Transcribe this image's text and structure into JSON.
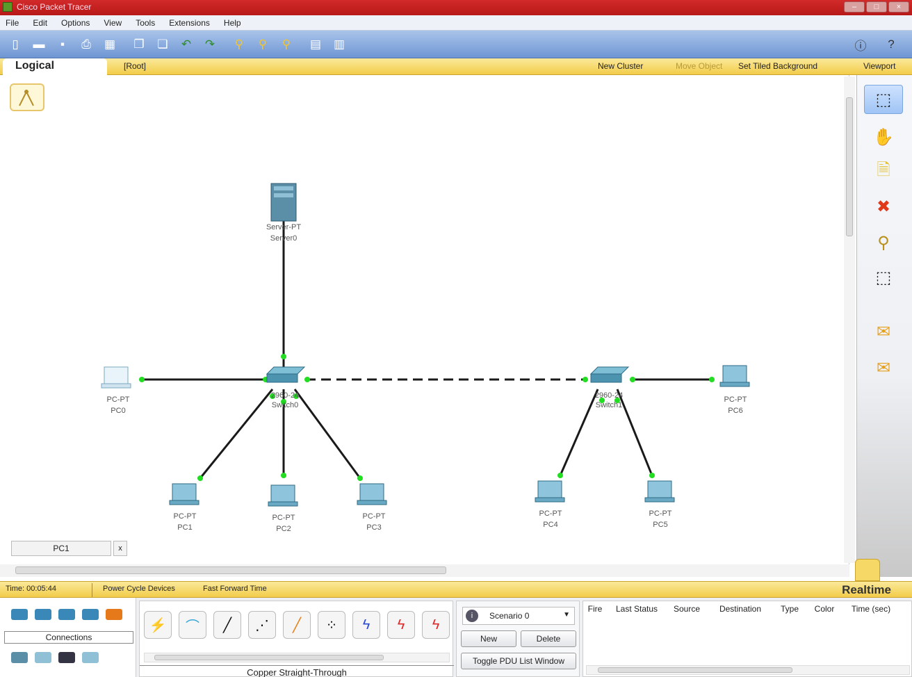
{
  "window": {
    "title": "Cisco Packet Tracer"
  },
  "menu": [
    "File",
    "Edit",
    "Options",
    "View",
    "Tools",
    "Extensions",
    "Help"
  ],
  "toolbar": {
    "icons": [
      "new-icon",
      "open-icon",
      "save-icon",
      "print-icon",
      "activity-wizard-icon",
      "copy-icon",
      "paste-icon",
      "undo-icon",
      "redo-icon",
      "zoom-in-icon",
      "zoom-reset-icon",
      "zoom-out-icon",
      "palette-icon",
      "custom-device-icon"
    ],
    "right_icons": [
      "info-icon",
      "help-icon"
    ]
  },
  "logical_bar": {
    "tab": "Logical",
    "root": "[Root]",
    "new_cluster": "New Cluster",
    "move_object": "Move Object",
    "set_tiled_background": "Set Tiled Background",
    "viewport": "Viewport"
  },
  "topology": {
    "server": {
      "type": "Server-PT",
      "name": "Server0"
    },
    "switch0": {
      "type": "2960-24",
      "name": "Switch0"
    },
    "switch1": {
      "type": "2960-24",
      "name": "Switch1"
    },
    "pcs": [
      {
        "type": "PC-PT",
        "name": "PC0"
      },
      {
        "type": "PC-PT",
        "name": "PC1"
      },
      {
        "type": "PC-PT",
        "name": "PC2"
      },
      {
        "type": "PC-PT",
        "name": "PC3"
      },
      {
        "type": "PC-PT",
        "name": "PC4"
      },
      {
        "type": "PC-PT",
        "name": "PC5"
      },
      {
        "type": "PC-PT",
        "name": "PC6"
      }
    ],
    "link_color": "#1a1a1a",
    "port_color": "#22dd22"
  },
  "workspace": {
    "pc_tab": "PC1",
    "pc_tab_close": "x"
  },
  "right_palette": [
    "select-icon",
    "hand-icon",
    "note-icon",
    "delete-icon",
    "inspect-icon",
    "resize-icon",
    "simple-pdu-icon",
    "complex-pdu-icon"
  ],
  "status": {
    "time": "Time: 00:05:44",
    "power_cycle": "Power Cycle Devices",
    "fast_forward": "Fast Forward Time",
    "mode": "Realtime"
  },
  "bottom": {
    "connections_label": "Connections",
    "cable_name": "Copper Straight-Through",
    "scenario": "Scenario 0",
    "new_button": "New",
    "delete_button": "Delete",
    "toggle_button": "Toggle PDU List Window",
    "pdu_columns": [
      "Fire",
      "Last Status",
      "Source",
      "Destination",
      "Type",
      "Color",
      "Time (sec)"
    ]
  }
}
